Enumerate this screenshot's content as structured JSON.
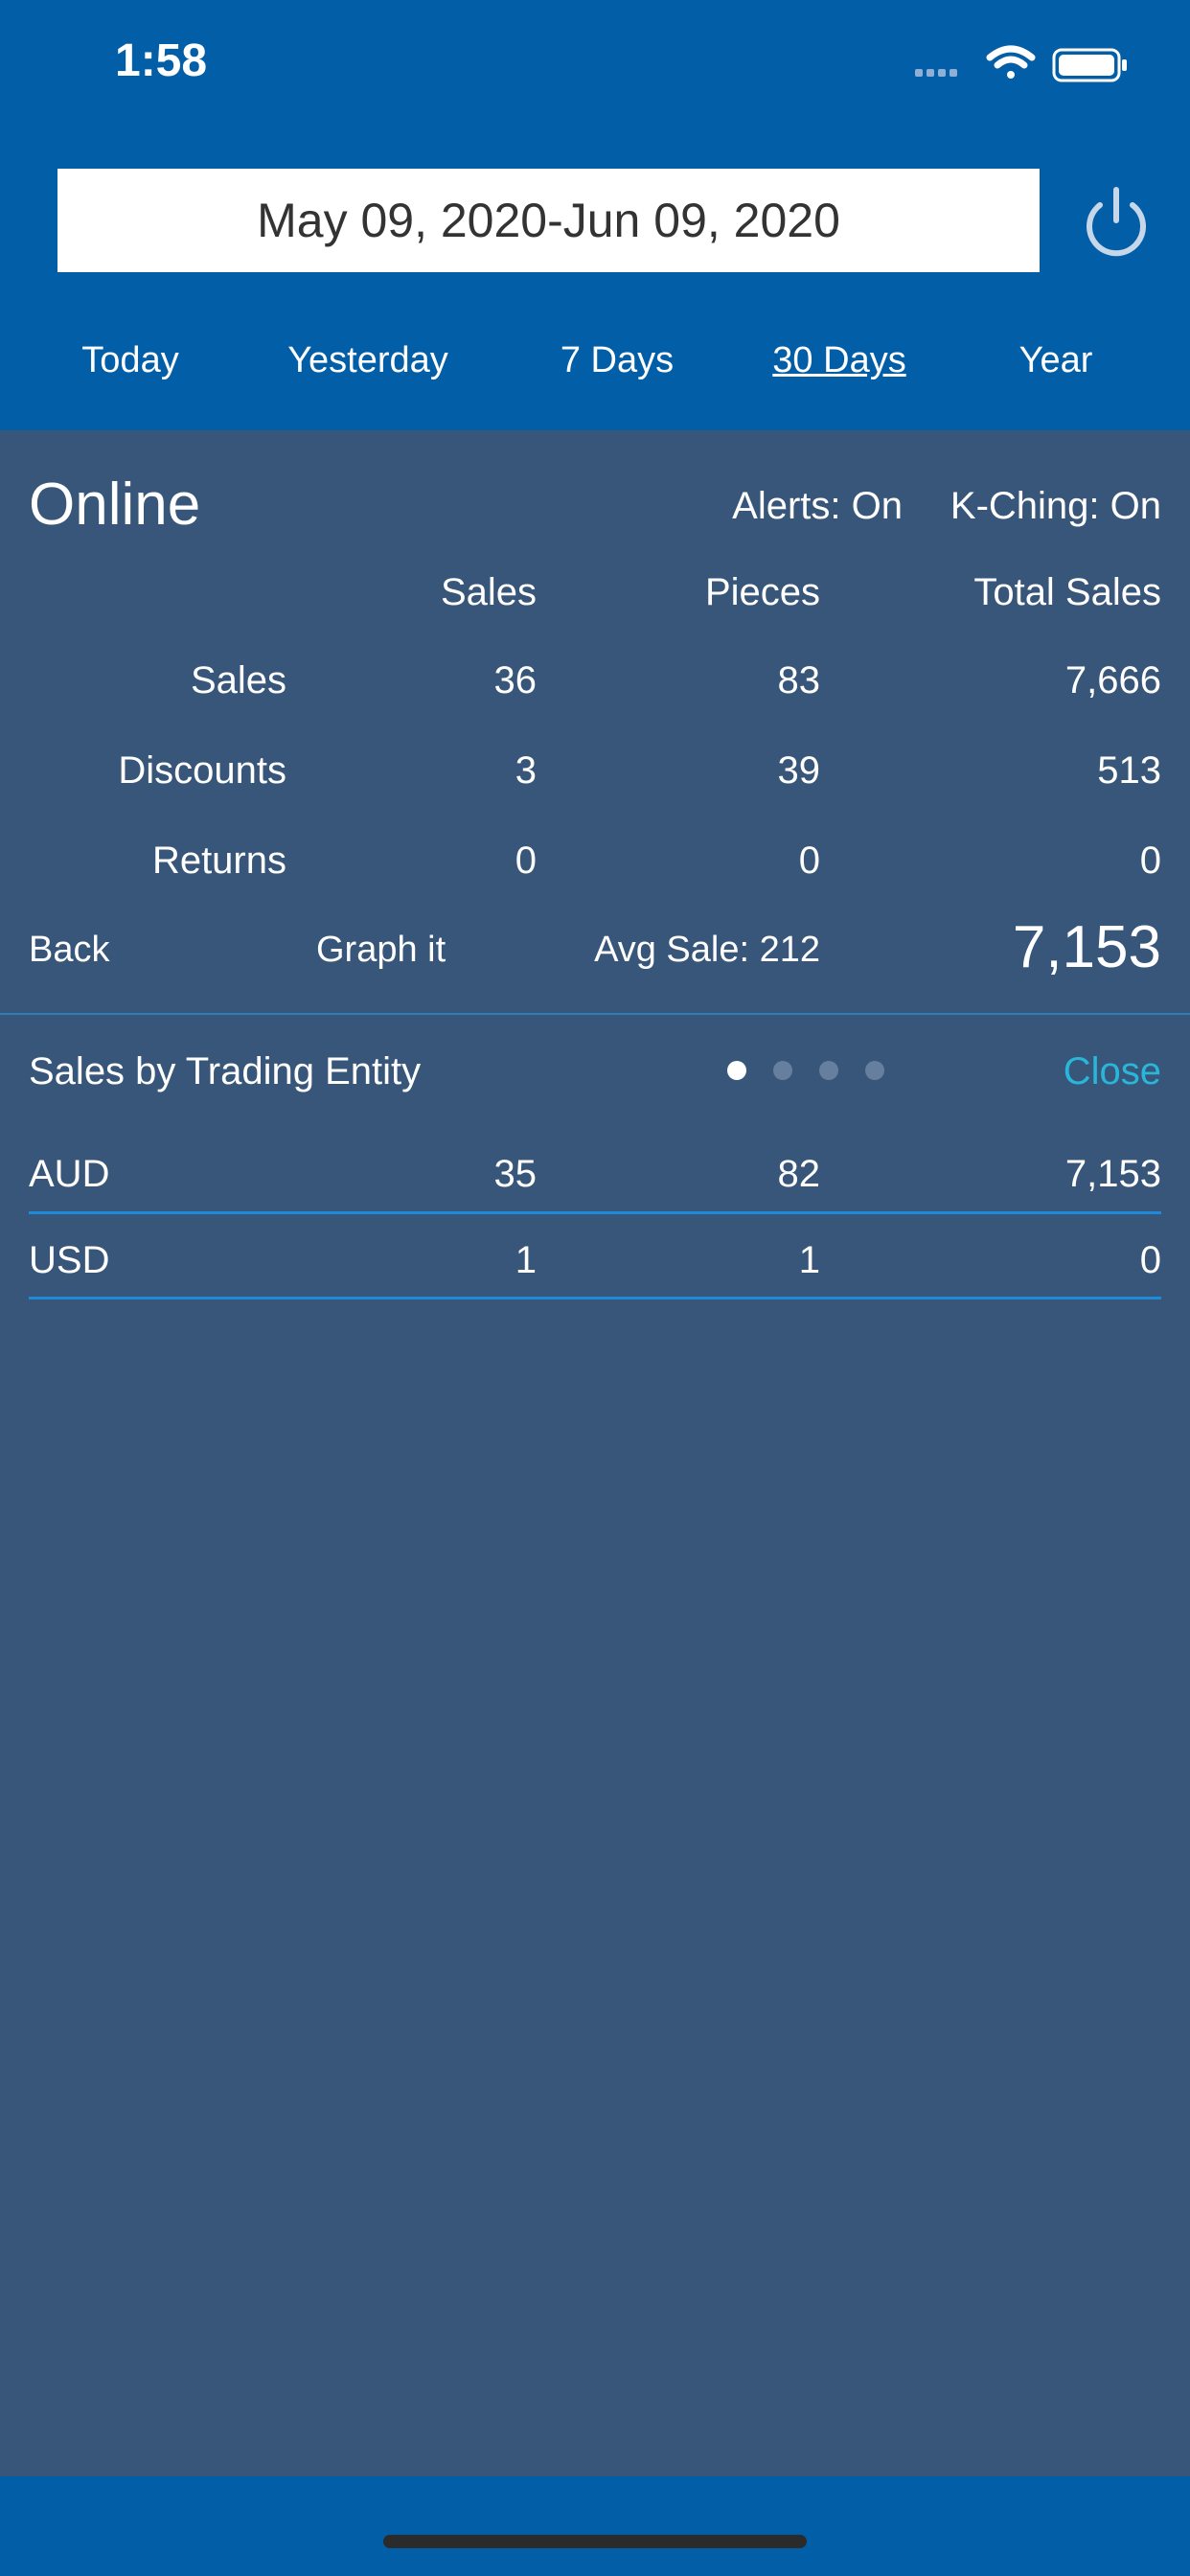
{
  "status_bar": {
    "time": "1:58",
    "icons": [
      "signal-icon",
      "wifi-icon",
      "battery-icon"
    ]
  },
  "date_range": {
    "start": "May 09, 2020",
    "separator": "-",
    "end": "Jun 09, 2020"
  },
  "ranges": [
    {
      "label": "Today",
      "active": false
    },
    {
      "label": "Yesterday",
      "active": false
    },
    {
      "label": "7 Days",
      "active": false
    },
    {
      "label": "30 Days",
      "active": true
    },
    {
      "label": "Year",
      "active": false
    }
  ],
  "store": {
    "name": "Online",
    "alerts": "Alerts: On",
    "kching": "K-Ching: On"
  },
  "table": {
    "headers": [
      "Sales",
      "Pieces",
      "Total Sales"
    ],
    "rows": [
      {
        "label": "Sales",
        "sales": "36",
        "pieces": "83",
        "total": "7,666"
      },
      {
        "label": "Discounts",
        "sales": "3",
        "pieces": "39",
        "total": "513"
      },
      {
        "label": "Returns",
        "sales": "0",
        "pieces": "0",
        "total": "0"
      }
    ]
  },
  "actions": {
    "back": "Back",
    "graph": "Graph it",
    "avg_sale": "Avg Sale: 212",
    "net_total": "7,153"
  },
  "entity_section": {
    "title": "Sales by Trading Entity",
    "close": "Close",
    "page_count": 4,
    "current_page": 1,
    "rows": [
      {
        "currency": "AUD",
        "sales": "35",
        "pieces": "82",
        "total": "7,153"
      },
      {
        "currency": "USD",
        "sales": "1",
        "pieces": "1",
        "total": "0"
      }
    ]
  },
  "colors": {
    "header_bg": "#035ea8",
    "content_bg": "#37567a",
    "accent": "#29b6d8",
    "row_line": "#1f8ad9"
  }
}
